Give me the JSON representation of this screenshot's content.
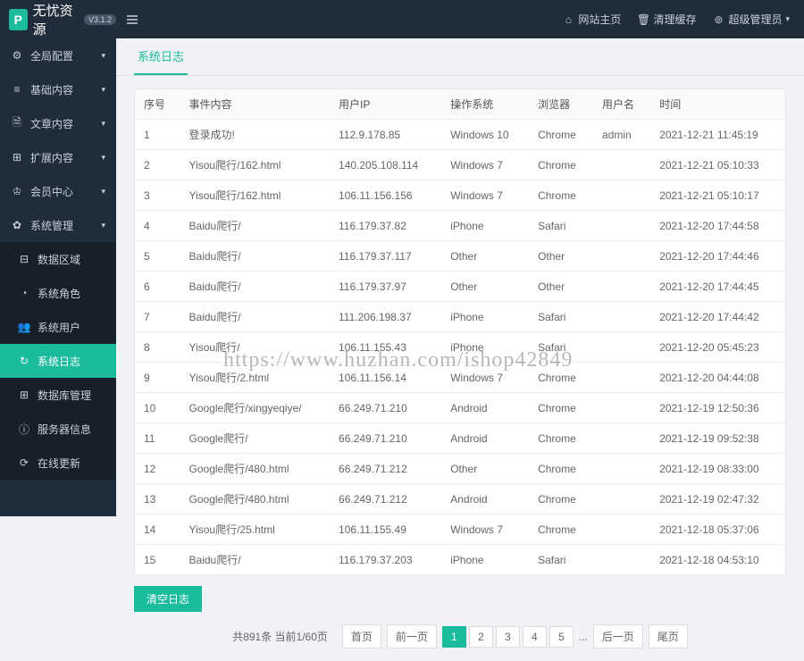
{
  "header": {
    "brand": "无忧资源",
    "version": "V3.1.2",
    "links": {
      "home": "网站主页",
      "cache": "清理缓存",
      "admin": "超级管理员"
    }
  },
  "sidebar": {
    "items": [
      {
        "icon": "gear",
        "label": "全局配置",
        "chev": true
      },
      {
        "icon": "list",
        "label": "基础内容",
        "chev": true
      },
      {
        "icon": "file",
        "label": "文章内容",
        "chev": true
      },
      {
        "icon": "ext",
        "label": "扩展内容",
        "chev": true
      },
      {
        "icon": "user",
        "label": "会员中心",
        "chev": true
      },
      {
        "icon": "cog",
        "label": "系统管理",
        "chev": true
      },
      {
        "icon": "db",
        "label": "数据区域",
        "sub": true
      },
      {
        "icon": "role",
        "label": "系统角色",
        "sub": true
      },
      {
        "icon": "users",
        "label": "系统用户",
        "sub": true
      },
      {
        "icon": "log",
        "label": "系统日志",
        "sub": true,
        "active": true
      },
      {
        "icon": "dbm",
        "label": "数据库管理",
        "sub": true
      },
      {
        "icon": "srv",
        "label": "服务器信息",
        "sub": true
      },
      {
        "icon": "upd",
        "label": "在线更新",
        "sub": true
      }
    ]
  },
  "tab": {
    "title": "系统日志"
  },
  "table": {
    "headers": [
      "序号",
      "事件内容",
      "用户IP",
      "操作系统",
      "浏览器",
      "用户名",
      "时间"
    ],
    "rows": [
      [
        "1",
        "登录成功!",
        "112.9.178.85",
        "Windows 10",
        "Chrome",
        "admin",
        "2021-12-21 11:45:19"
      ],
      [
        "2",
        "Yisou爬行/162.html",
        "140.205.108.114",
        "Windows 7",
        "Chrome",
        "",
        "2021-12-21 05:10:33"
      ],
      [
        "3",
        "Yisou爬行/162.html",
        "106.11.156.156",
        "Windows 7",
        "Chrome",
        "",
        "2021-12-21 05:10:17"
      ],
      [
        "4",
        "Baidu爬行/",
        "116.179.37.82",
        "iPhone",
        "Safari",
        "",
        "2021-12-20 17:44:58"
      ],
      [
        "5",
        "Baidu爬行/",
        "116.179.37.117",
        "Other",
        "Other",
        "",
        "2021-12-20 17:44:46"
      ],
      [
        "6",
        "Baidu爬行/",
        "116.179.37.97",
        "Other",
        "Other",
        "",
        "2021-12-20 17:44:45"
      ],
      [
        "7",
        "Baidu爬行/",
        "111.206.198.37",
        "iPhone",
        "Safari",
        "",
        "2021-12-20 17:44:42"
      ],
      [
        "8",
        "Yisou爬行/",
        "106.11.155.43",
        "iPhone",
        "Safari",
        "",
        "2021-12-20 05:45:23"
      ],
      [
        "9",
        "Yisou爬行/2.html",
        "106.11.156.14",
        "Windows 7",
        "Chrome",
        "",
        "2021-12-20 04:44:08"
      ],
      [
        "10",
        "Google爬行/xingyeqiye/",
        "66.249.71.210",
        "Android",
        "Chrome",
        "",
        "2021-12-19 12:50:36"
      ],
      [
        "11",
        "Google爬行/",
        "66.249.71.210",
        "Android",
        "Chrome",
        "",
        "2021-12-19 09:52:38"
      ],
      [
        "12",
        "Google爬行/480.html",
        "66.249.71.212",
        "Other",
        "Chrome",
        "",
        "2021-12-19 08:33:00"
      ],
      [
        "13",
        "Google爬行/480.html",
        "66.249.71.212",
        "Android",
        "Chrome",
        "",
        "2021-12-19 02:47:32"
      ],
      [
        "14",
        "Yisou爬行/25.html",
        "106.11.155.49",
        "Windows 7",
        "Chrome",
        "",
        "2021-12-18 05:37:06"
      ],
      [
        "15",
        "Baidu爬行/",
        "116.179.37.203",
        "iPhone",
        "Safari",
        "",
        "2021-12-18 04:53:10"
      ]
    ]
  },
  "buttons": {
    "clear": "清空日志"
  },
  "pagination": {
    "info": "共891条 当前1/60页",
    "first": "首页",
    "prev": "前一页",
    "next": "后一页",
    "last": "尾页",
    "pages": [
      "1",
      "2",
      "3",
      "4",
      "5"
    ],
    "ellipsis": "..."
  },
  "watermark": "https://www.huzhan.com/ishop42849"
}
